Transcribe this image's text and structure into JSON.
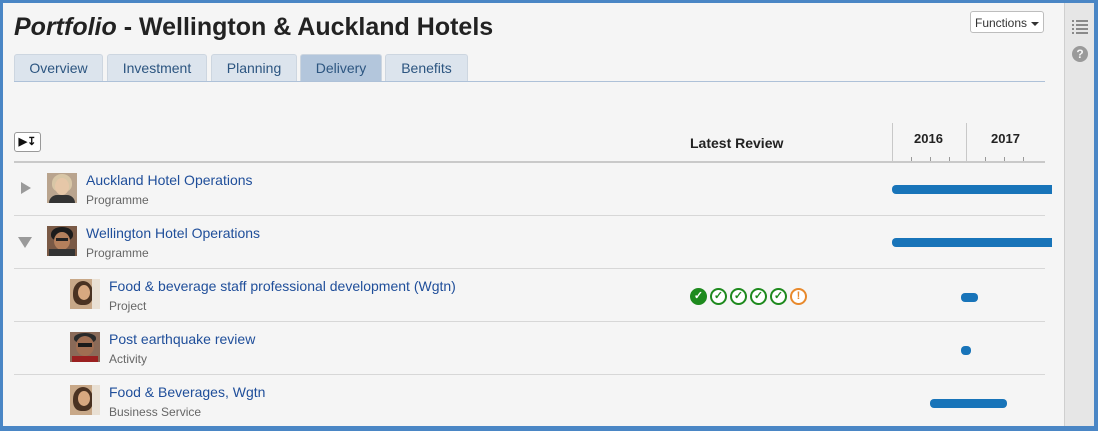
{
  "header": {
    "title_italic": "Portfolio",
    "title_rest": " - Wellington & Auckland Hotels",
    "functions_label": "Functions"
  },
  "tabs": [
    {
      "label": "Overview",
      "active": false
    },
    {
      "label": "Investment",
      "active": false
    },
    {
      "label": "Planning",
      "active": false
    },
    {
      "label": "Delivery",
      "active": true
    },
    {
      "label": "Benefits",
      "active": false
    }
  ],
  "table": {
    "expand_button_label": "▶↧",
    "latest_review_header": "Latest Review",
    "years": [
      "2016",
      "2017"
    ]
  },
  "rows": [
    {
      "title": "Auckland Hotel Operations",
      "type": "Programme",
      "expanded": false,
      "indent": 0
    },
    {
      "title": "Wellington Hotel Operations",
      "type": "Programme",
      "expanded": true,
      "indent": 0
    },
    {
      "title": "Food & beverage staff professional development (Wgtn)",
      "type": "Project",
      "indent": 1,
      "reviews": [
        "ok-filled",
        "ok",
        "ok",
        "ok",
        "ok",
        "warning"
      ]
    },
    {
      "title": "Post earthquake review",
      "type": "Activity",
      "indent": 1
    },
    {
      "title": "Food & Beverages, Wgtn",
      "type": "Business Service",
      "indent": 1
    }
  ],
  "icons": {
    "list": "list-icon",
    "help": "help-icon",
    "help_glyph": "?",
    "check_glyph": "✓",
    "warning_glyph": "!"
  },
  "colors": {
    "bar": "#1874b9",
    "review_ok": "#1e8a1e",
    "review_warning": "#e8892c",
    "link": "#1f4e9a"
  }
}
